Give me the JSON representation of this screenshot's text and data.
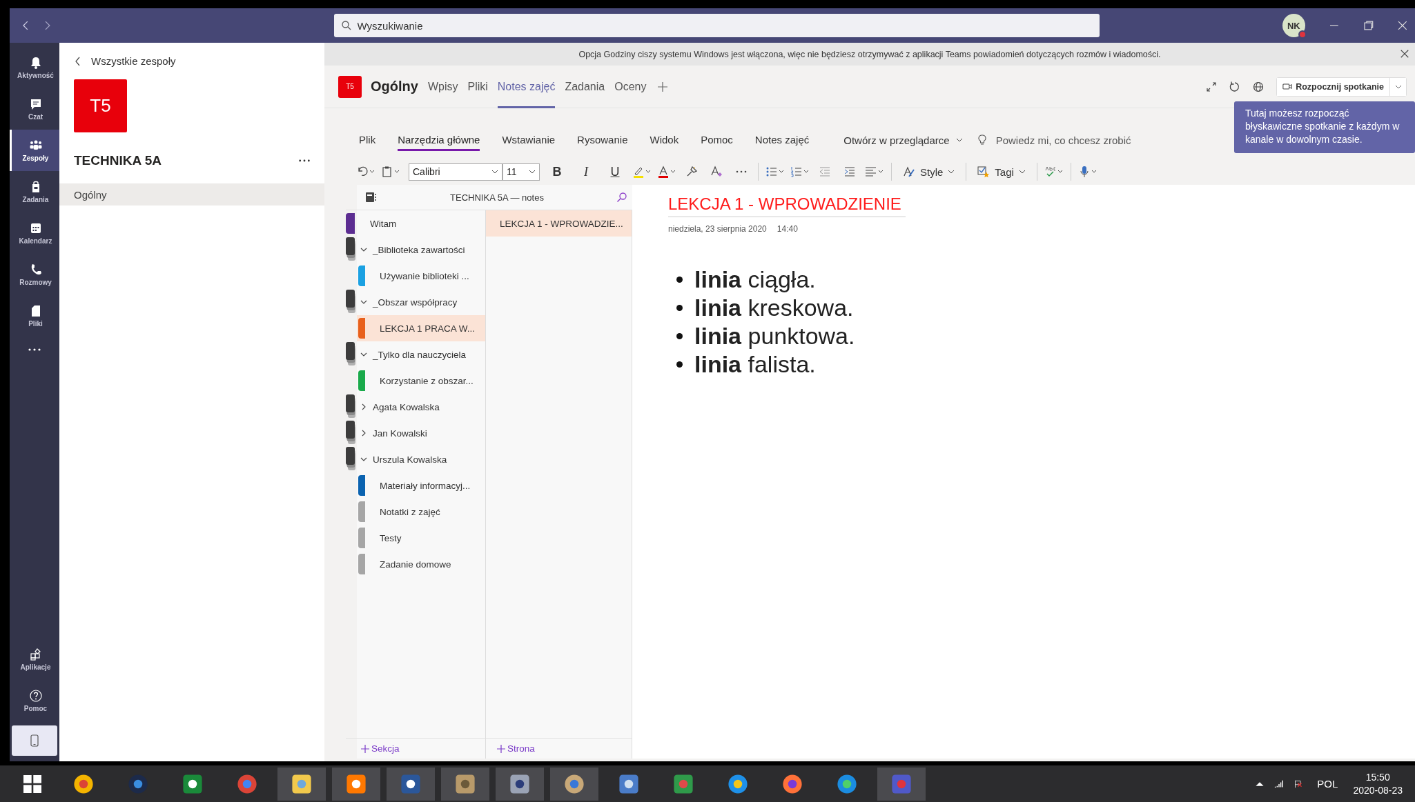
{
  "title_bar": {
    "search": {
      "placeholder": "Wyszukiwanie"
    },
    "avatar": {
      "initials": "NK"
    }
  },
  "notice": {
    "text": "Opcja Godziny ciszy systemu Windows jest włączona, więc nie będziesz otrzymywać z aplikacji Teams powiadomień dotyczących rozmów i wiadomości."
  },
  "rail": {
    "items": [
      {
        "label": "Aktywność",
        "kind": "activity",
        "selected": false
      },
      {
        "label": "Czat",
        "kind": "chat",
        "selected": false
      },
      {
        "label": "Zespoły",
        "kind": "teams",
        "selected": true
      },
      {
        "label": "Zadania",
        "kind": "assignments",
        "selected": false
      },
      {
        "label": "Kalendarz",
        "kind": "calendar",
        "selected": false
      },
      {
        "label": "Rozmowy",
        "kind": "calls",
        "selected": false
      },
      {
        "label": "Pliki",
        "kind": "files",
        "selected": false
      }
    ],
    "bottom_items": [
      {
        "label": "Aplikacje",
        "kind": "apps",
        "selected": false
      },
      {
        "label": "Pomoc",
        "kind": "help",
        "selected": false
      }
    ]
  },
  "teams_panel": {
    "back_link": "Wszystkie zespoły",
    "team_tile": "T5",
    "team_name": "TECHNIKA 5A",
    "channels": [
      {
        "name": "Ogólny",
        "selected": true
      }
    ]
  },
  "channel_header": {
    "tile": "T5",
    "name": "Ogólny",
    "tabs": [
      {
        "label": "Wpisy",
        "selected": false
      },
      {
        "label": "Pliki",
        "selected": false
      },
      {
        "label": "Notes zajęć",
        "selected": true
      },
      {
        "label": "Zadania",
        "selected": false
      },
      {
        "label": "Oceny",
        "selected": false
      }
    ],
    "meet_button": "Rozpocznij spotkanie"
  },
  "tooltip": {
    "text": "Tutaj możesz rozpocząć błyskawiczne spotkanie z każdym w kanale w dowolnym czasie."
  },
  "ribbon": {
    "tabs": [
      {
        "label": "Plik",
        "selected": false
      },
      {
        "label": "Narzędzia główne",
        "selected": true
      },
      {
        "label": "Wstawianie",
        "selected": false
      },
      {
        "label": "Rysowanie",
        "selected": false
      },
      {
        "label": "Widok",
        "selected": false
      },
      {
        "label": "Pomoc",
        "selected": false
      },
      {
        "label": "Notes zajęć",
        "selected": false
      }
    ],
    "open_in_browser": "Otwórz w przeglądarce",
    "tell_me": {
      "placeholder": "Powiedz mi, co chcesz zrobić"
    },
    "font": "Calibri",
    "size": "11",
    "bold": "B",
    "italic": "I",
    "underline": "U",
    "style_label": "Style",
    "tags_label": "Tagi"
  },
  "notebook": {
    "title": "TECHNIKA 5A — notes",
    "sections": [
      {
        "kind": "section",
        "label": "Witam",
        "color": "#5c2d91",
        "selected": false
      },
      {
        "kind": "group",
        "label": "_Biblioteka zawartości",
        "expanded": true,
        "children": [
          {
            "label": "Używanie biblioteki ...",
            "color": "#1ba1e2",
            "selected": false
          }
        ]
      },
      {
        "kind": "group",
        "label": "_Obszar współpracy",
        "expanded": true,
        "children": [
          {
            "label": "LEKCJA 1 PRACA W...",
            "color": "#e8601c",
            "selected": true
          }
        ]
      },
      {
        "kind": "group",
        "label": "_Tylko dla nauczyciela",
        "expanded": true,
        "children": [
          {
            "label": "Korzystanie z obszar...",
            "color": "#1aaa4b",
            "selected": false
          }
        ]
      },
      {
        "kind": "group",
        "label": "Agata Kowalska",
        "expanded": false
      },
      {
        "kind": "group",
        "label": "Jan Kowalski",
        "expanded": false
      },
      {
        "kind": "group",
        "label": "Urszula Kowalska",
        "expanded": true,
        "children": [
          {
            "label": "Materiały informacyj...",
            "color": "#0b63b0",
            "selected": false
          },
          {
            "label": "Notatki z zajęć",
            "color": "#a6a6a6",
            "selected": false
          },
          {
            "label": "Testy",
            "color": "#a6a6a6",
            "selected": false
          },
          {
            "label": "Zadanie domowe",
            "color": "#a6a6a6",
            "selected": false
          }
        ]
      }
    ],
    "add_section": "Sekcja",
    "pages": [
      {
        "title": "LEKCJA 1  - WPROWADZIE...",
        "selected": true
      }
    ],
    "add_page": "Strona"
  },
  "page": {
    "title": "LEKCJA 1  - WPROWADZIENIE",
    "date": "niedziela, 23 sierpnia 2020",
    "time": "14:40",
    "bullets": [
      "**linia** ciągła.",
      "**linia** kreskowa.",
      "**linia** punktowa.",
      "**linia** falista."
    ]
  },
  "taskbar": {
    "apps": [
      {
        "kind": "picasa",
        "running": false
      },
      {
        "kind": "camera",
        "running": false
      },
      {
        "kind": "store",
        "running": false
      },
      {
        "kind": "chrome",
        "running": false
      },
      {
        "kind": "explorer",
        "running": true
      },
      {
        "kind": "avast",
        "running": true
      },
      {
        "kind": "word",
        "running": true
      },
      {
        "kind": "archive",
        "running": true
      },
      {
        "kind": "scanner",
        "running": true
      },
      {
        "kind": "paint",
        "running": true
      },
      {
        "kind": "network",
        "running": false
      },
      {
        "kind": "mail",
        "running": false
      },
      {
        "kind": "ie",
        "running": false
      },
      {
        "kind": "firefox",
        "running": false
      },
      {
        "kind": "edge",
        "running": false
      },
      {
        "kind": "teams",
        "running": true
      }
    ],
    "language": "POL",
    "time": "15:50",
    "date": "2020-08-23"
  }
}
